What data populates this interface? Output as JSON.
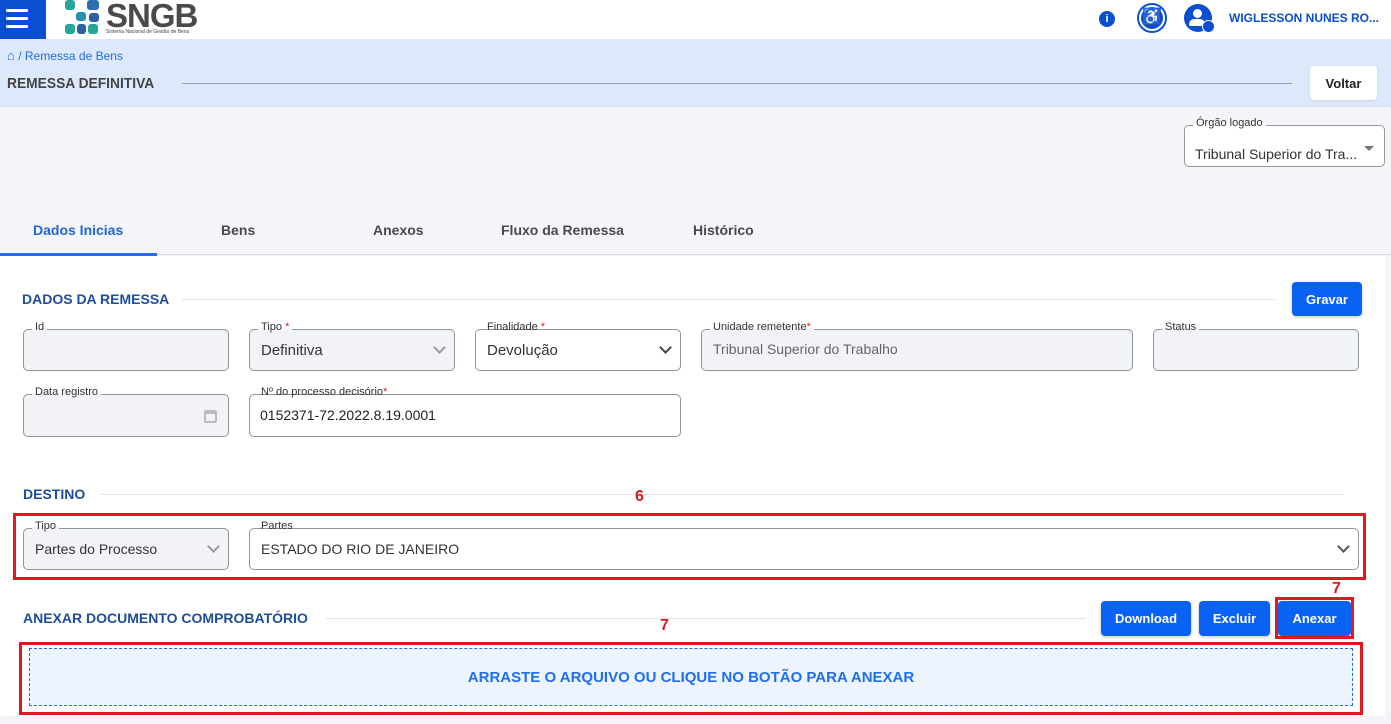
{
  "topbar": {
    "logo_title": "SNGB",
    "logo_subtitle": "Sistema Nacional de Gestão de Bens",
    "user_name": "WIGLESSON NUNES RO...",
    "brand_color": "#0a4fcf"
  },
  "header": {
    "breadcrumb": "/ Remessa de Bens",
    "title": "REMESSA DEFINITIVA",
    "back_label": "Voltar"
  },
  "orgao": {
    "label": "Órgão logado",
    "value": "Tribunal Superior do Tra..."
  },
  "tabs": [
    {
      "label": "Dados Inicias",
      "active": true
    },
    {
      "label": "Bens"
    },
    {
      "label": "Anexos"
    },
    {
      "label": "Fluxo da Remessa"
    },
    {
      "label": "Histórico"
    }
  ],
  "dados": {
    "title": "DADOS DA REMESSA",
    "save_label": "Gravar",
    "id": {
      "label": "Id",
      "value": ""
    },
    "tipo": {
      "label": "Tipo",
      "value": "Definitiva"
    },
    "finalidade": {
      "label": "Finalidade",
      "value": "Devolução"
    },
    "unidade": {
      "label": "Unidade remetente",
      "value": "Tribunal Superior do Trabalho"
    },
    "status": {
      "label": "Status",
      "value": ""
    },
    "data_registro": {
      "label": "Data registro",
      "value": ""
    },
    "processo": {
      "label": "Nº do processo decisório",
      "value": "0152371-72.2022.8.19.0001"
    },
    "required_mark": "*"
  },
  "destino": {
    "title": "DESTINO",
    "tipo": {
      "label": "Tipo",
      "value": "Partes do Processo"
    },
    "partes": {
      "label": "Partes",
      "value": "ESTADO DO RIO DE JANEIRO"
    }
  },
  "anexar": {
    "title": "ANEXAR DOCUMENTO COMPROBATÓRIO",
    "download_label": "Download",
    "excluir_label": "Excluir",
    "anexar_label": "Anexar",
    "dropzone_text": "ARRASTE O ARQUIVO OU CLIQUE NO BOTÃO PARA ANEXAR"
  },
  "annotations": {
    "a6": "6",
    "a7_button": "7",
    "a7_dropzone": "7",
    "color": "#e0181f"
  }
}
